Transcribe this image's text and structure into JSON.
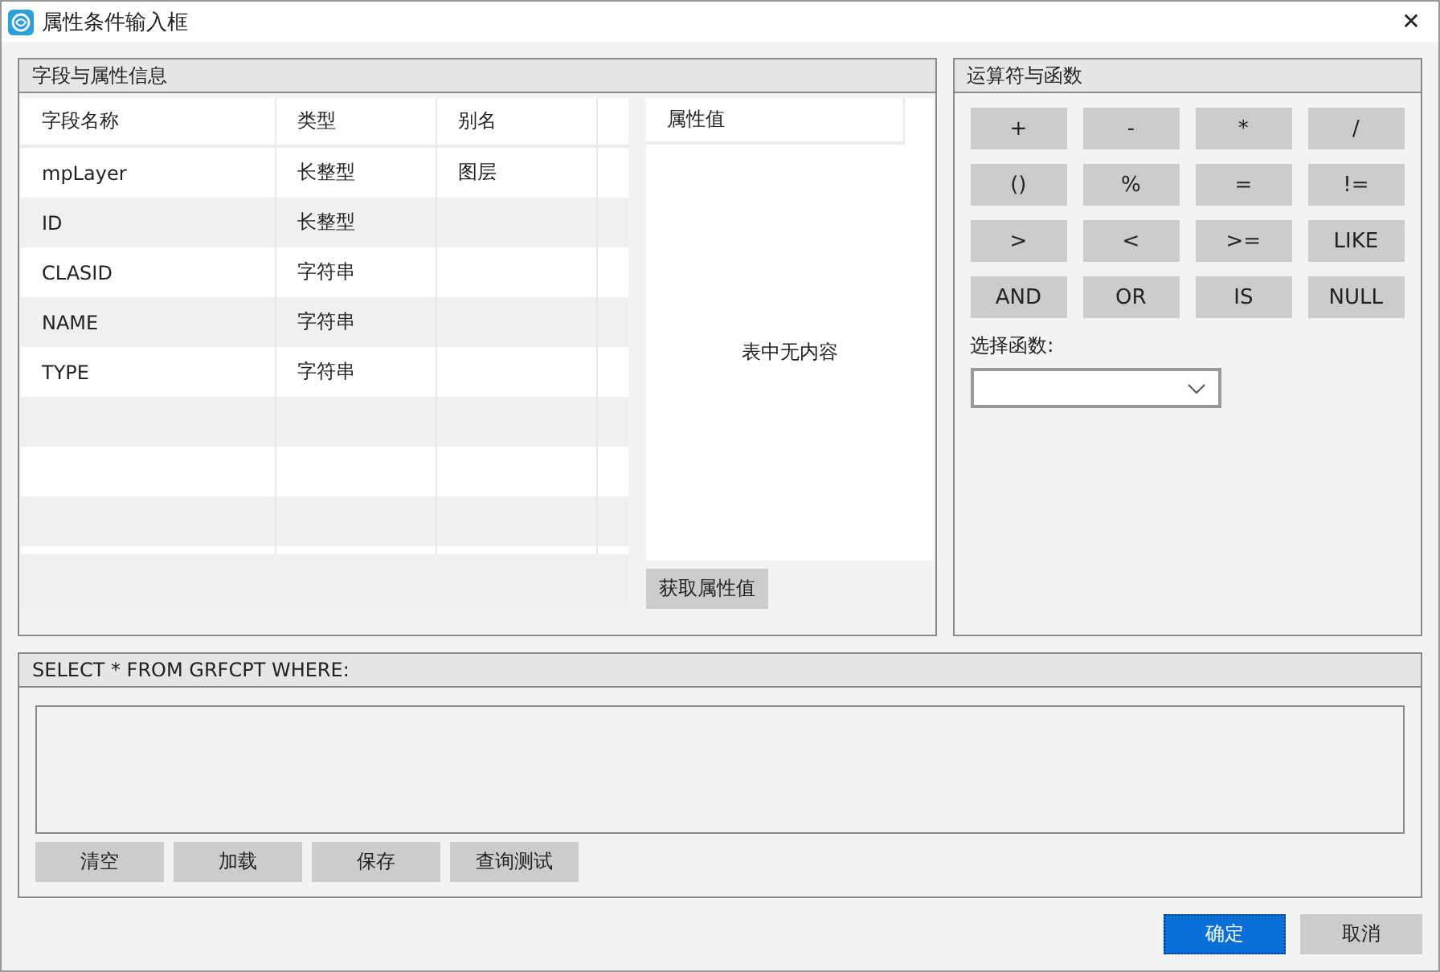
{
  "window": {
    "title": "属性条件输入框",
    "close": "✕"
  },
  "fields_panel": {
    "title": "字段与属性信息",
    "table": {
      "columns": [
        "字段名称",
        "类型",
        "别名"
      ],
      "rows": [
        {
          "cells": [
            "mpLayer",
            "长整型",
            "图层"
          ]
        },
        {
          "cells": [
            "ID",
            "长整型",
            ""
          ]
        },
        {
          "cells": [
            "CLASID",
            "字符串",
            ""
          ]
        },
        {
          "cells": [
            "NAME",
            "字符串",
            ""
          ]
        },
        {
          "cells": [
            "TYPE",
            "字符串",
            ""
          ]
        }
      ]
    },
    "values_list": {
      "header": "属性值",
      "empty_text": "表中无内容"
    },
    "get_values_button": "获取属性值"
  },
  "operators_panel": {
    "title": "运算符与函数",
    "operators": [
      "+",
      "-",
      "*",
      "/",
      "()",
      "%",
      "=",
      "!=",
      ">",
      "<",
      ">=",
      "LIKE",
      "AND",
      "OR",
      "IS",
      "NULL"
    ],
    "function_label": "选择函数:"
  },
  "query_panel": {
    "title": "SELECT * FROM GRFCPT WHERE:",
    "buttons": [
      "清空",
      "加载",
      "保存",
      "查询测试"
    ]
  },
  "dialog_buttons": [
    {
      "label": "确定",
      "kind": "primary"
    },
    {
      "label": "取消",
      "kind": "normal"
    }
  ]
}
